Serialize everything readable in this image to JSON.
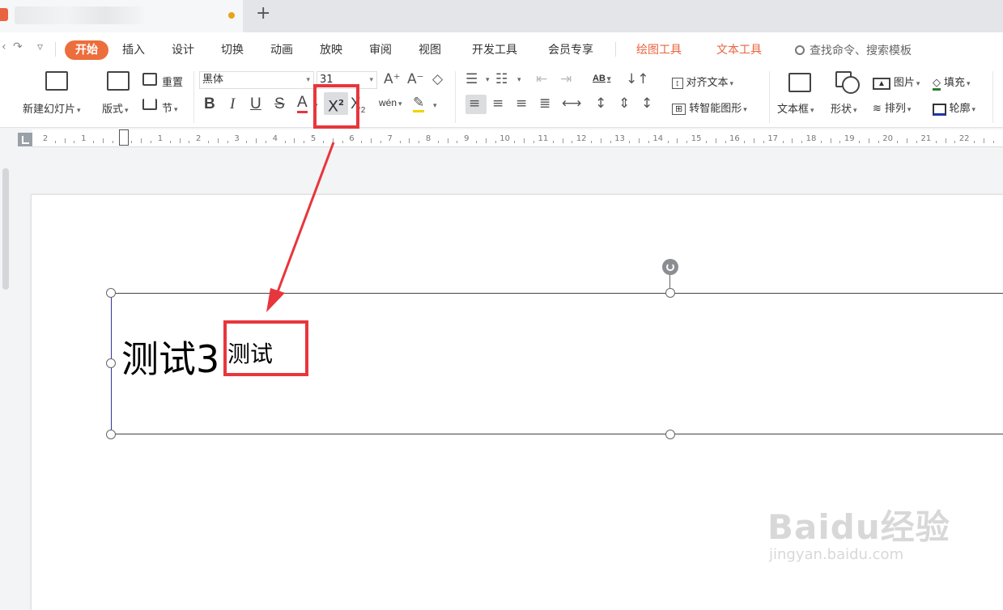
{
  "window": {
    "new_tab_symbol": "+"
  },
  "menu": {
    "tabs": [
      "开始",
      "插入",
      "设计",
      "切换",
      "动画",
      "放映",
      "审阅",
      "视图",
      "开发工具",
      "会员专享",
      "绘图工具",
      "文本工具"
    ],
    "active_tab": "开始",
    "search_placeholder": "查找命令、搜索模板"
  },
  "ribbon": {
    "new_slide": "新建幻灯片",
    "layout": "版式",
    "reset": "重置",
    "section": "节",
    "font_name": "黑体",
    "font_size": "31",
    "bold": "B",
    "italic": "I",
    "underline": "U",
    "strike": "S",
    "font_color": "A",
    "superscript": "X",
    "superscript_mark": "2",
    "subscript": "X",
    "subscript_mark": "2",
    "pinyin": "wén",
    "align_text": "对齐文本",
    "smart_shape": "转智能图形",
    "textbox": "文本框",
    "shape": "形状",
    "picture": "图片",
    "arrange": "排列",
    "fill": "填充",
    "outline": "轮廓",
    "text_dir": "AB"
  },
  "ruler": {
    "labels": [
      "2",
      "1",
      "",
      "1",
      "2",
      "3",
      "4",
      "5",
      "6",
      "7",
      "8",
      "9",
      "10",
      "11",
      "12",
      "13",
      "14",
      "15",
      "16",
      "17",
      "18",
      "19",
      "20",
      "21",
      "22"
    ]
  },
  "slide": {
    "main_text": "测试3",
    "superscript_text": "测试"
  },
  "watermark": {
    "logo": "Baidu经验",
    "url": "jingyan.baidu.com"
  },
  "colors": {
    "accent": "#ec6e3c",
    "annotation": "#e8363c"
  }
}
